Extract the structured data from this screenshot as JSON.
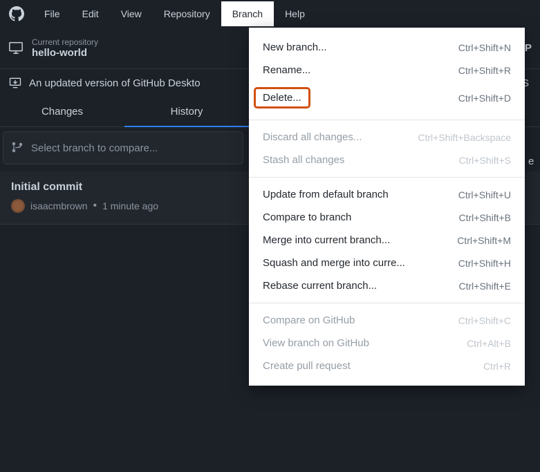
{
  "menubar": {
    "items": [
      "File",
      "Edit",
      "View",
      "Repository",
      "Branch",
      "Help"
    ],
    "active_index": 4
  },
  "toolbar": {
    "repo_label": "Current repository",
    "repo_name": "hello-world",
    "right_letter": "P"
  },
  "notice": {
    "text": "An updated version of GitHub Deskto",
    "right_letter": "S"
  },
  "tabs": {
    "items": [
      "Changes",
      "History"
    ],
    "active_index": 1
  },
  "branch_select": {
    "placeholder": "Select branch to compare..."
  },
  "commit": {
    "title": "Initial commit",
    "author": "isaacmbrown",
    "time": "1 minute ago"
  },
  "dropdown": {
    "right_letter": "e",
    "groups": [
      [
        {
          "label": "New branch...",
          "shortcut": "Ctrl+Shift+N",
          "disabled": false,
          "highlight": false
        },
        {
          "label": "Rename...",
          "shortcut": "Ctrl+Shift+R",
          "disabled": false,
          "highlight": false
        },
        {
          "label": "Delete...",
          "shortcut": "Ctrl+Shift+D",
          "disabled": false,
          "highlight": true
        }
      ],
      [
        {
          "label": "Discard all changes...",
          "shortcut": "Ctrl+Shift+Backspace",
          "disabled": true,
          "highlight": false
        },
        {
          "label": "Stash all changes",
          "shortcut": "Ctrl+Shift+S",
          "disabled": true,
          "highlight": false
        }
      ],
      [
        {
          "label": "Update from default branch",
          "shortcut": "Ctrl+Shift+U",
          "disabled": false,
          "highlight": false
        },
        {
          "label": "Compare to branch",
          "shortcut": "Ctrl+Shift+B",
          "disabled": false,
          "highlight": false
        },
        {
          "label": "Merge into current branch...",
          "shortcut": "Ctrl+Shift+M",
          "disabled": false,
          "highlight": false
        },
        {
          "label": "Squash and merge into curre...",
          "shortcut": "Ctrl+Shift+H",
          "disabled": false,
          "highlight": false
        },
        {
          "label": "Rebase current branch...",
          "shortcut": "Ctrl+Shift+E",
          "disabled": false,
          "highlight": false
        }
      ],
      [
        {
          "label": "Compare on GitHub",
          "shortcut": "Ctrl+Shift+C",
          "disabled": true,
          "highlight": false
        },
        {
          "label": "View branch on GitHub",
          "shortcut": "Ctrl+Alt+B",
          "disabled": true,
          "highlight": false
        },
        {
          "label": "Create pull request",
          "shortcut": "Ctrl+R",
          "disabled": true,
          "highlight": false
        }
      ]
    ]
  }
}
